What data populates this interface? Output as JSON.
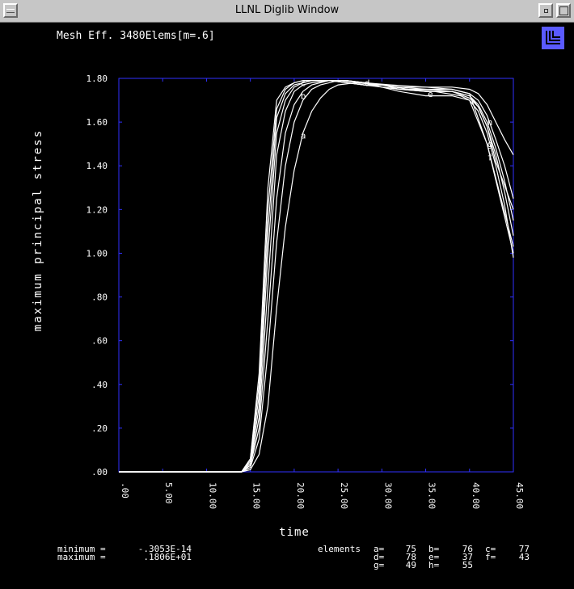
{
  "window": {
    "title": "LLNL Diglib Window"
  },
  "header": {
    "plot_title": "Mesh Eff. 3480Elems[m=.6]"
  },
  "logo": {
    "name": "llnl-logo",
    "color": "#5a5aff"
  },
  "colors": {
    "axis": "#3030ff",
    "curve": "#ffffff",
    "background": "#000000"
  },
  "stats": {
    "minimum_label": "minimum =",
    "minimum_value": "-.3053E-14",
    "maximum_label": "maximum =",
    "maximum_value": ".1806E+01",
    "elements_label": "elements",
    "elements": [
      [
        "a=",
        "75"
      ],
      [
        "b=",
        "76"
      ],
      [
        "c=",
        "77"
      ],
      [
        "d=",
        "78"
      ],
      [
        "e=",
        "37"
      ],
      [
        "f=",
        "43"
      ],
      [
        "g=",
        "49"
      ],
      [
        "h=",
        "55"
      ]
    ]
  },
  "chart_data": {
    "type": "line",
    "xlabel": "time",
    "ylabel": "maximum principal stress",
    "xlim": [
      0,
      45
    ],
    "ylim": [
      0,
      1.8
    ],
    "xticks": [
      0,
      5,
      10,
      15,
      20,
      25,
      30,
      35,
      40,
      45
    ],
    "xtick_labels": [
      ".00",
      "5.00",
      "10.00",
      "15.00",
      "20.00",
      "25.00",
      "30.00",
      "35.00",
      "40.00",
      "45.00"
    ],
    "yticks": [
      0,
      0.2,
      0.4,
      0.6,
      0.8,
      1.0,
      1.2,
      1.4,
      1.6,
      1.8
    ],
    "ytick_labels": [
      ".00",
      ".20",
      ".40",
      ".60",
      ".80",
      "1.00",
      "1.20",
      "1.40",
      "1.60",
      "1.80"
    ],
    "grid": false,
    "series": [
      {
        "name": "a",
        "label_at": [
          21,
          1.54
        ],
        "x": [
          0,
          14,
          15,
          16,
          17,
          18,
          19,
          20,
          21,
          22,
          23,
          24,
          25,
          27,
          30,
          33,
          36,
          39,
          40,
          42,
          45
        ],
        "y": [
          0,
          0,
          0.01,
          0.08,
          0.3,
          0.75,
          1.12,
          1.38,
          1.55,
          1.65,
          1.71,
          1.75,
          1.77,
          1.78,
          1.77,
          1.75,
          1.74,
          1.72,
          1.7,
          1.5,
          1.03
        ]
      },
      {
        "name": "b",
        "label_at": [
          21,
          1.72
        ],
        "x": [
          0,
          14,
          15,
          16,
          17,
          18,
          19,
          20,
          21,
          22,
          23,
          24,
          25,
          28,
          31,
          35,
          38,
          40,
          42,
          45
        ],
        "y": [
          0,
          0,
          0.02,
          0.15,
          0.55,
          1.05,
          1.4,
          1.6,
          1.7,
          1.75,
          1.77,
          1.78,
          1.79,
          1.78,
          1.77,
          1.76,
          1.75,
          1.73,
          1.5,
          1.0
        ]
      },
      {
        "name": "c",
        "label_at": [
          21,
          1.78
        ],
        "x": [
          0,
          14,
          15,
          16,
          17,
          18,
          19,
          20,
          21,
          22,
          24,
          26,
          28,
          30,
          32,
          35,
          38,
          40,
          41,
          42,
          43,
          45
        ],
        "y": [
          0,
          0,
          0.03,
          0.2,
          0.7,
          1.25,
          1.55,
          1.68,
          1.74,
          1.77,
          1.79,
          1.79,
          1.78,
          1.77,
          1.75,
          1.74,
          1.74,
          1.72,
          1.67,
          1.58,
          1.42,
          1.2
        ]
      },
      {
        "name": "d",
        "label_at": [
          28.3,
          1.78
        ],
        "x": [
          0,
          14,
          15,
          16,
          17,
          18,
          19,
          20,
          21,
          22,
          24,
          26,
          28,
          30,
          32,
          35,
          38,
          40,
          41,
          42,
          43,
          44,
          45
        ],
        "y": [
          0,
          0,
          0.03,
          0.25,
          0.85,
          1.45,
          1.65,
          1.74,
          1.77,
          1.78,
          1.79,
          1.79,
          1.78,
          1.76,
          1.74,
          1.72,
          1.72,
          1.7,
          1.65,
          1.55,
          1.4,
          1.22,
          0.98
        ]
      },
      {
        "name": "e",
        "label_at": [
          35.5,
          1.73
        ],
        "x": [
          0,
          14,
          15,
          16,
          17,
          18,
          19,
          20,
          21,
          22,
          24,
          26,
          28,
          30,
          32,
          35,
          38,
          40,
          41,
          42,
          43,
          44,
          45
        ],
        "y": [
          0,
          0,
          0.04,
          0.3,
          1.0,
          1.55,
          1.7,
          1.76,
          1.78,
          1.79,
          1.79,
          1.79,
          1.78,
          1.76,
          1.75,
          1.74,
          1.74,
          1.71,
          1.67,
          1.58,
          1.45,
          1.28,
          1.08
        ]
      },
      {
        "name": "f",
        "label_at": [
          42.3,
          1.44
        ],
        "x": [
          0,
          14,
          15,
          16,
          17,
          18,
          19,
          20,
          21,
          22,
          24,
          26,
          28,
          30,
          32,
          35,
          38,
          40,
          41,
          42,
          43,
          44,
          45
        ],
        "y": [
          0,
          0,
          0.05,
          0.35,
          1.1,
          1.62,
          1.73,
          1.77,
          1.78,
          1.79,
          1.79,
          1.78,
          1.77,
          1.76,
          1.75,
          1.75,
          1.74,
          1.72,
          1.68,
          1.6,
          1.48,
          1.33,
          1.15
        ]
      },
      {
        "name": "g",
        "label_at": [
          42.3,
          1.5
        ],
        "x": [
          0,
          14,
          15,
          16,
          17,
          18,
          19,
          20,
          21,
          22,
          24,
          26,
          28,
          30,
          32,
          35,
          38,
          40,
          41,
          42,
          43,
          44,
          45
        ],
        "y": [
          0,
          0,
          0.06,
          0.4,
          1.2,
          1.66,
          1.75,
          1.78,
          1.79,
          1.79,
          1.79,
          1.78,
          1.77,
          1.77,
          1.76,
          1.75,
          1.75,
          1.73,
          1.7,
          1.63,
          1.52,
          1.4,
          1.25
        ]
      },
      {
        "name": "h",
        "label_at": [
          42.3,
          1.6
        ],
        "x": [
          0,
          14,
          15,
          16,
          17,
          18,
          19,
          20,
          21,
          22,
          24,
          26,
          28,
          30,
          32,
          35,
          38,
          40,
          41,
          42,
          43,
          44,
          45
        ],
        "y": [
          0,
          0,
          0.06,
          0.45,
          1.3,
          1.7,
          1.76,
          1.78,
          1.79,
          1.79,
          1.79,
          1.78,
          1.77,
          1.77,
          1.76,
          1.76,
          1.76,
          1.75,
          1.73,
          1.68,
          1.6,
          1.52,
          1.45
        ]
      }
    ]
  }
}
